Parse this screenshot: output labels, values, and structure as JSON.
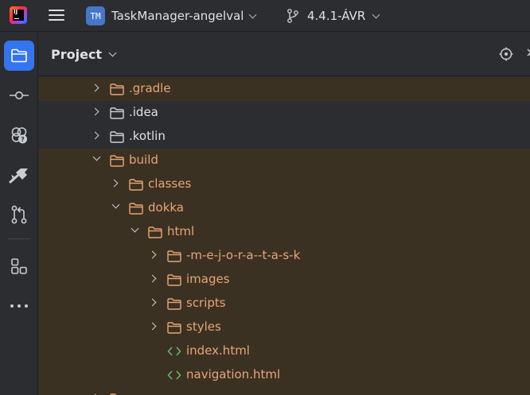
{
  "titlebar": {
    "project_badge": "TM",
    "project_name": "TaskManager-angelval",
    "branch_name": "4.4.1-ÁVR"
  },
  "toolstrip": {
    "items": [
      {
        "name": "project-tool",
        "icon": "folder-icon",
        "active": true
      },
      {
        "name": "commit-tool",
        "icon": "commit-icon",
        "active": false
      },
      {
        "name": "ai-assistant-tool",
        "icon": "ai-assistant-icon",
        "active": false
      },
      {
        "name": "build-tool",
        "icon": "hammer-icon",
        "active": false
      },
      {
        "name": "pull-requests-tool",
        "icon": "pull-request-icon",
        "active": false
      },
      {
        "name": "structure-tool",
        "icon": "structure-icon",
        "active": false
      },
      {
        "name": "more-tools",
        "icon": "more-icon",
        "active": false
      }
    ]
  },
  "panel": {
    "title": "Project"
  },
  "tree": [
    {
      "label": ".gradle",
      "depth": 0,
      "expanded": false,
      "kind": "folder",
      "excluded": true
    },
    {
      "label": ".idea",
      "depth": 0,
      "expanded": false,
      "kind": "folder",
      "excluded": false
    },
    {
      "label": ".kotlin",
      "depth": 0,
      "expanded": false,
      "kind": "folder",
      "excluded": false
    },
    {
      "label": "build",
      "depth": 0,
      "expanded": true,
      "kind": "folder",
      "excluded": true
    },
    {
      "label": "classes",
      "depth": 1,
      "expanded": false,
      "kind": "folder",
      "excluded": true
    },
    {
      "label": "dokka",
      "depth": 1,
      "expanded": true,
      "kind": "folder",
      "excluded": true
    },
    {
      "label": "html",
      "depth": 2,
      "expanded": true,
      "kind": "folder",
      "excluded": true
    },
    {
      "label": "-m-e-j-o-r-a--t-a-s-k",
      "depth": 3,
      "expanded": false,
      "kind": "folder",
      "excluded": true
    },
    {
      "label": "images",
      "depth": 3,
      "expanded": false,
      "kind": "folder",
      "excluded": true
    },
    {
      "label": "scripts",
      "depth": 3,
      "expanded": false,
      "kind": "folder",
      "excluded": true
    },
    {
      "label": "styles",
      "depth": 3,
      "expanded": false,
      "kind": "folder",
      "excluded": true
    },
    {
      "label": "index.html",
      "depth": 3,
      "expanded": null,
      "kind": "html",
      "excluded": true
    },
    {
      "label": "navigation.html",
      "depth": 3,
      "expanded": null,
      "kind": "html",
      "excluded": true
    },
    {
      "label": "",
      "depth": 0,
      "expanded": false,
      "kind": "folder",
      "excluded": true
    }
  ],
  "colors": {
    "accent": "#3574f0",
    "excluded_bg": "#3b3123",
    "excluded_text": "#e8a573",
    "normal_text": "#dfe1e5",
    "html_icon": "#5fb865"
  }
}
